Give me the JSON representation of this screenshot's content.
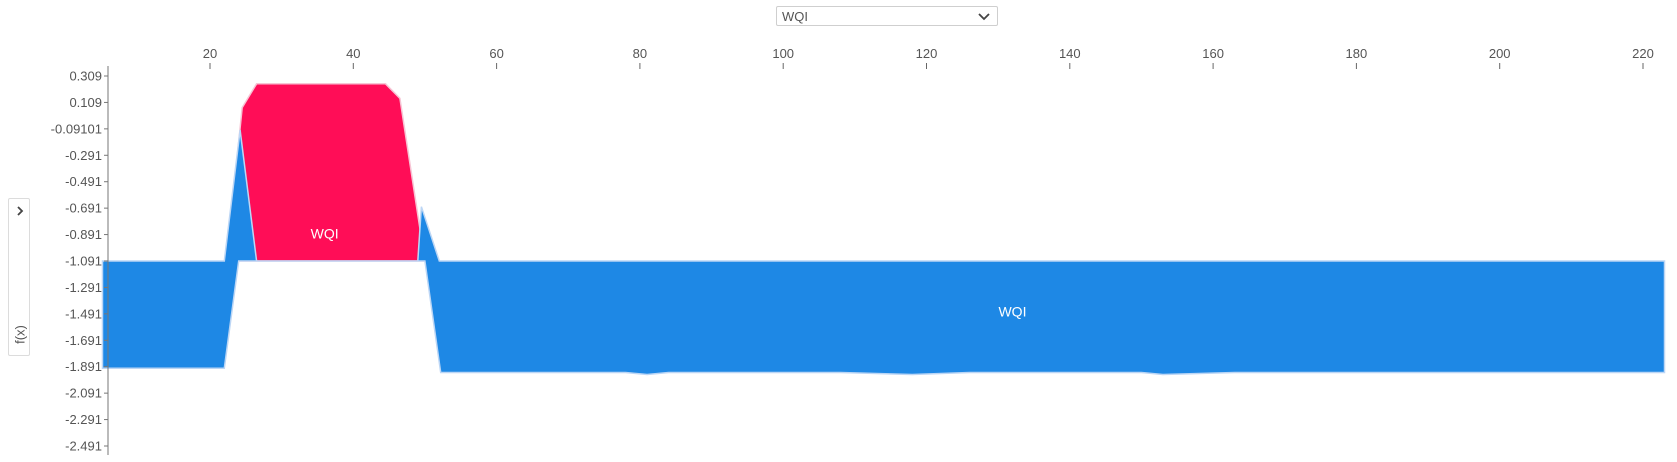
{
  "selector": {
    "value": "WQI",
    "icon": "chevron-down-icon"
  },
  "side_panel": {
    "label": "f(x)",
    "icon": "chevron-right-icon"
  },
  "chart_data": {
    "type": "area",
    "x_ticks": [
      20,
      40,
      60,
      80,
      100,
      120,
      140,
      160,
      180,
      200,
      220
    ],
    "y_ticks": [
      "0.309",
      "0.109",
      "-0.09101",
      "-0.291",
      "-0.491",
      "-0.691",
      "-0.891",
      "-1.091",
      "-1.291",
      "-1.491",
      "-1.691",
      "-1.891",
      "-2.091",
      "-2.291",
      "-2.491"
    ],
    "xlim": [
      5,
      223
    ],
    "ylim": [
      -2.55,
      0.39
    ],
    "series": [
      {
        "name": "WQI",
        "color": "#ff0d57",
        "upper": [
          [
            22.3,
            -1.091
          ],
          [
            24.5,
            0.07
          ],
          [
            26.5,
            0.25
          ],
          [
            44.5,
            0.25
          ],
          [
            46.5,
            0.14
          ],
          [
            50,
            -1.091
          ]
        ],
        "lower": [
          [
            22.3,
            -1.091
          ],
          [
            24.5,
            -1.091
          ],
          [
            50,
            -1.091
          ]
        ]
      },
      {
        "name": "WQI",
        "color": "#1e88e5",
        "upper": [
          [
            5,
            -1.091
          ],
          [
            22,
            -1.091
          ],
          [
            24.2,
            -0.1
          ],
          [
            26.5,
            -1.091
          ],
          [
            49,
            -1.091
          ],
          [
            49.5,
            -0.68
          ],
          [
            52,
            -1.091
          ],
          [
            223,
            -1.091
          ]
        ],
        "lower": [
          [
            5,
            -1.902
          ],
          [
            22,
            -1.902
          ],
          [
            24,
            -1.091
          ],
          [
            26.5,
            -1.091
          ],
          [
            50,
            -1.091
          ],
          [
            52.2,
            -1.935
          ],
          [
            78,
            -1.935
          ],
          [
            81,
            -1.95
          ],
          [
            84,
            -1.935
          ],
          [
            108,
            -1.935
          ],
          [
            118,
            -1.95
          ],
          [
            126,
            -1.935
          ],
          [
            150,
            -1.935
          ],
          [
            153,
            -1.95
          ],
          [
            163,
            -1.935
          ],
          [
            223,
            -1.935
          ]
        ]
      }
    ],
    "labels": [
      {
        "text": "WQI",
        "x": 36,
        "y": -0.92
      },
      {
        "text": "WQI",
        "x": 132,
        "y": -1.51
      }
    ]
  }
}
